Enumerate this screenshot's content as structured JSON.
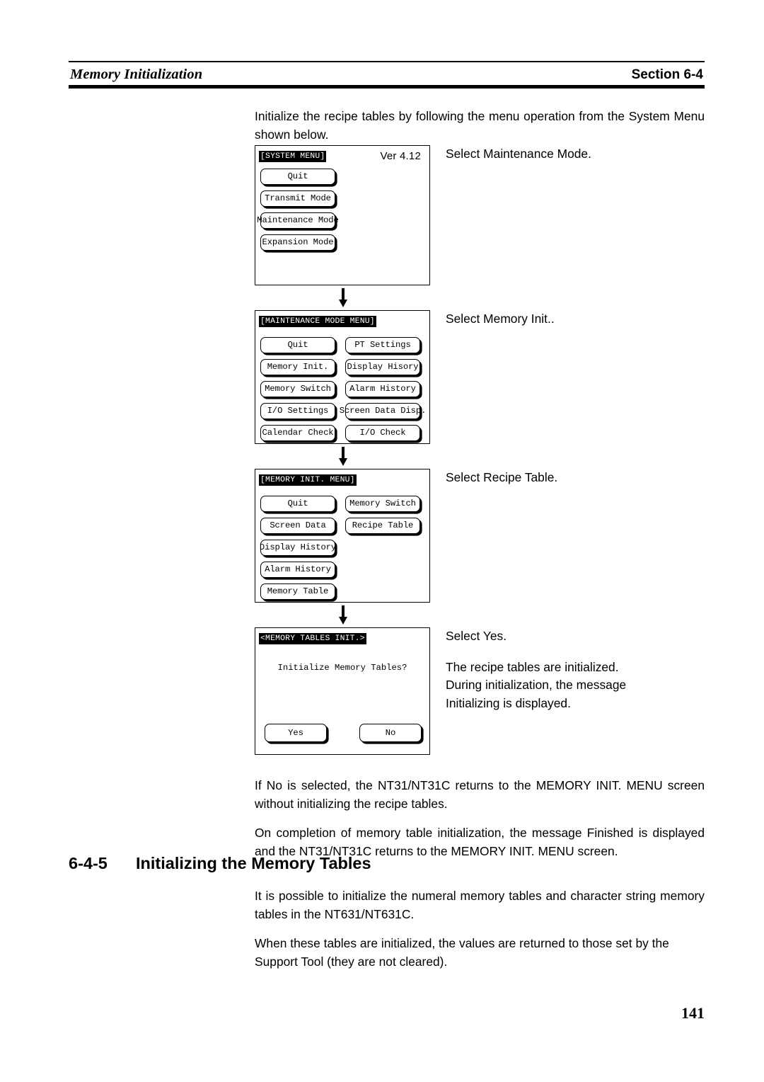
{
  "header": {
    "running_title": "Memory Initialization",
    "section_ref": "Section 6-4"
  },
  "intro": {
    "paragraph": "Initialize the recipe tables by following the menu operation from the System Menu shown below."
  },
  "flow": {
    "steps": [
      {
        "screen": {
          "title": "[SYSTEM MENU]",
          "version": "Ver 4.12",
          "buttons_left": [
            "Quit",
            "Transmit Mode",
            "Maintenance Mode",
            "Expansion Mode"
          ],
          "buttons_right": []
        },
        "annotation_lines": [
          "Select Maintenance Mode."
        ]
      },
      {
        "screen": {
          "title": "[MAINTENANCE MODE MENU]",
          "buttons_left": [
            "Quit",
            "Memory Init.",
            "Memory Switch",
            "I/O Settings",
            "Calendar Check"
          ],
          "buttons_right": [
            "PT Settings",
            "Display Hisory",
            "Alarm History",
            "Screen Data Disp.",
            "I/O Check"
          ]
        },
        "annotation_lines": [
          "Select Memory Init.."
        ]
      },
      {
        "screen": {
          "title": "[MEMORY INIT. MENU]",
          "buttons_left": [
            "Quit",
            "Screen Data",
            "Display History",
            "Alarm History",
            "Memory Table"
          ],
          "buttons_right": [
            "Memory Switch",
            "Recipe Table"
          ]
        },
        "annotation_lines": [
          "Select Recipe Table."
        ]
      },
      {
        "screen": {
          "title": "<MEMORY TABLES INIT.>",
          "message": "Initialize Memory Tables?",
          "button_yes": "Yes",
          "button_no": "No"
        },
        "annotation_lines": [
          "Select Yes.",
          "The recipe tables are initialized.",
          "During initialization, the message",
          "Initializing is displayed."
        ]
      }
    ]
  },
  "body": {
    "paragraph_no_selected": "If No is selected, the NT31/NT31C returns to the MEMORY INIT. MENU screen without initializing the recipe tables.",
    "paragraph_completion": "On completion of memory table initialization, the message Finished is displayed and the NT31/NT31C returns to the MEMORY INIT. MENU screen."
  },
  "section": {
    "number": "6-4-5",
    "title": "Initializing the Memory Tables",
    "paragraph_1": "It is possible to initialize the numeral memory tables and character string memory tables in the NT631/NT631C.",
    "paragraph_2": "When these tables are initialized, the values are returned to those set by the Support Tool (they are not cleared)."
  },
  "footer": {
    "page_number": "141"
  }
}
